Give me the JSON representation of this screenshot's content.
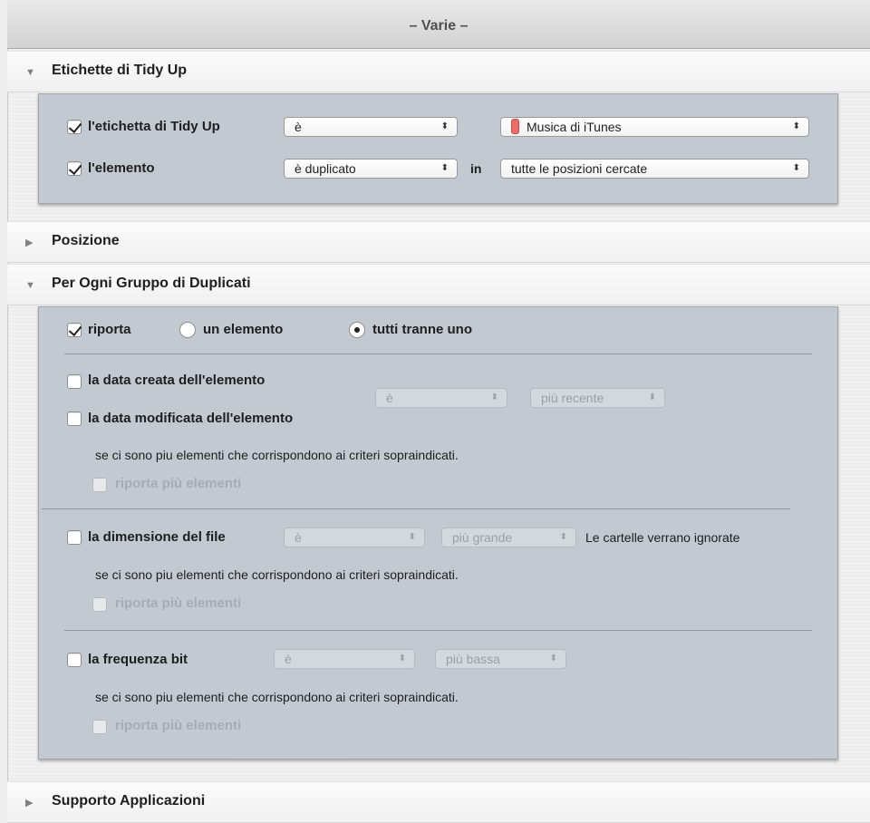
{
  "window": {
    "title": "– Varie –"
  },
  "colors": {
    "panel_bg": "#c2c9d0",
    "label_color": "#f06b6b",
    "header_bg": "#f4f4f4"
  },
  "sections": {
    "tidy_labels": {
      "title": "Etichette di Tidy Up",
      "expanded": true,
      "rows": {
        "label": {
          "checked": true,
          "text": "l'etichetta di Tidy Up",
          "operator": "è",
          "value": "Musica di iTunes"
        },
        "element": {
          "checked": true,
          "text": "l'elemento",
          "operator": "è duplicato",
          "connector": "in",
          "value": "tutte le posizioni cercate"
        }
      }
    },
    "position": {
      "title": "Posizione",
      "expanded": false
    },
    "per_group": {
      "title": "Per Ogni Gruppo di Duplicati",
      "expanded": true,
      "report": {
        "checked": true,
        "label": "riporta",
        "option_one": "un elemento",
        "option_all_but_one": "tutti tranne uno",
        "selected": "tutti tranne uno"
      },
      "date_block": {
        "created_label": "la data creata dell'elemento",
        "created_checked": false,
        "modified_label": "la data modificata dell'elemento",
        "modified_checked": false,
        "operator": "è",
        "order": "più recente",
        "note": "se ci sono piu elementi che corrispondono ai criteri sopraindicati.",
        "report_more": "riporta più elementi"
      },
      "size_block": {
        "label": "la dimensione del file",
        "checked": false,
        "operator": "è",
        "order": "più grande",
        "hint": "Le cartelle verrano ignorate",
        "note": "se ci sono piu elementi che corrispondono ai criteri sopraindicati.",
        "report_more": "riporta più elementi"
      },
      "bitrate_block": {
        "label": "la frequenza bit",
        "checked": false,
        "operator": "è",
        "order": "più bassa",
        "note": "se ci sono piu elementi che corrispondono ai criteri sopraindicati.",
        "report_more": "riporta più elementi"
      }
    },
    "app_support": {
      "title": "Supporto Applicazioni",
      "expanded": false
    }
  },
  "icons": {
    "expanded": "disclosure-triangle-down-icon",
    "collapsed": "disclosure-triangle-right-icon",
    "popup": "popup-arrows-icon",
    "color_label": "color-label-swatch-icon"
  }
}
